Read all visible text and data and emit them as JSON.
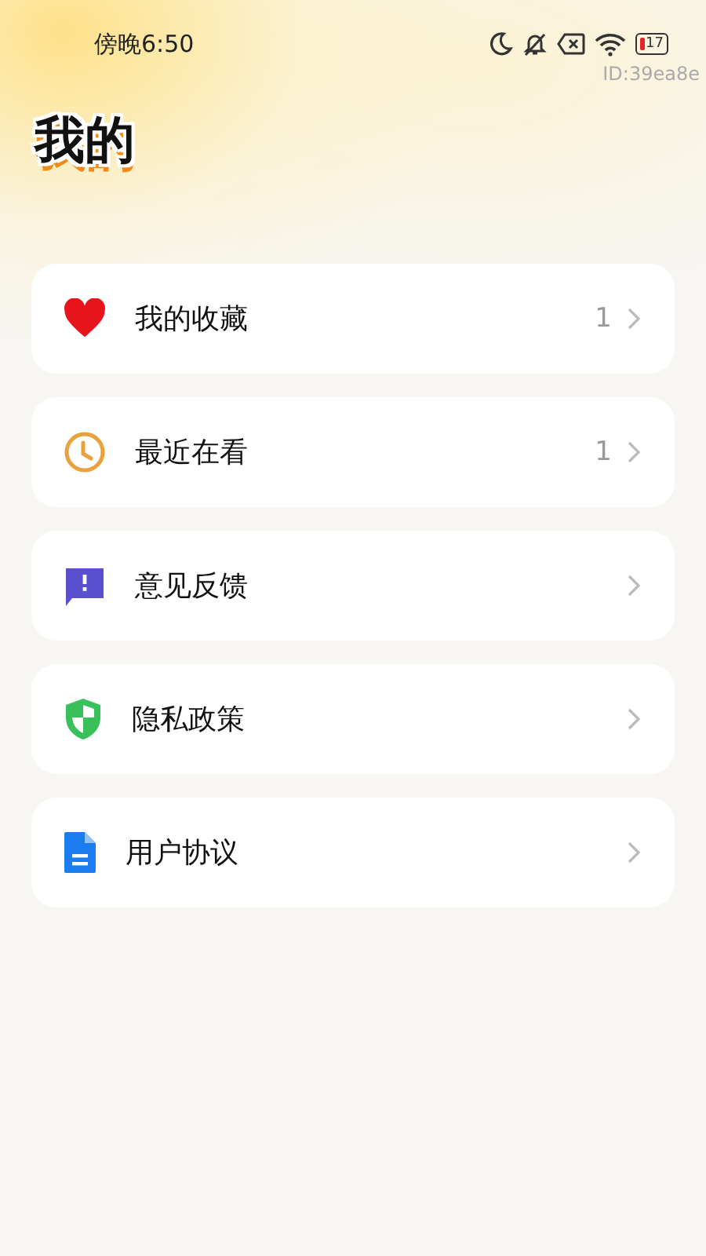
{
  "status_bar": {
    "time": "傍晚6:50",
    "battery": "17"
  },
  "id_label": "ID:39ea8e",
  "title": "我的",
  "menu": [
    {
      "kind": "heart",
      "label": "我的收藏",
      "count": "1"
    },
    {
      "kind": "clock",
      "label": "最近在看",
      "count": "1"
    },
    {
      "kind": "feedback",
      "label": "意见反馈"
    },
    {
      "kind": "shield",
      "label": "隐私政策"
    },
    {
      "kind": "document",
      "label": "用户协议"
    }
  ]
}
